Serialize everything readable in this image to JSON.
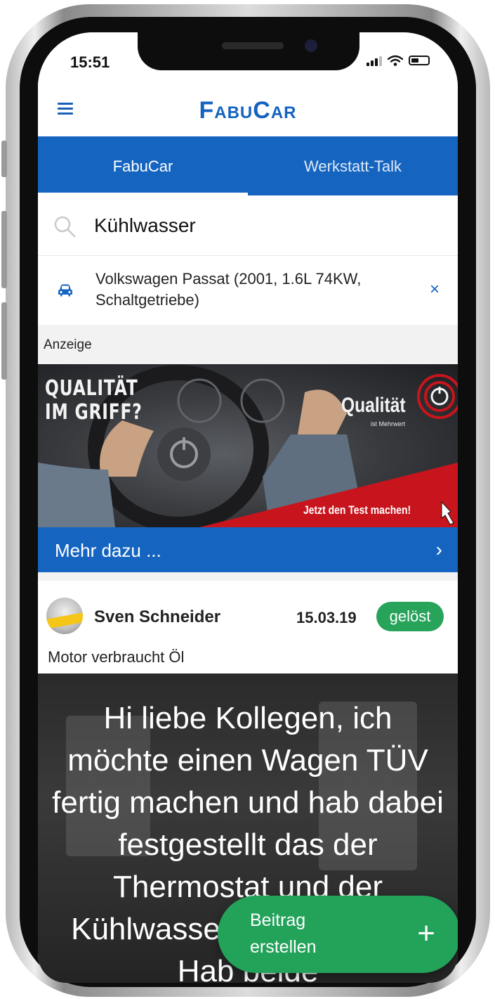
{
  "status_bar": {
    "time": "15:51"
  },
  "header": {
    "logo": "FabuCar"
  },
  "tabs": [
    {
      "label": "FabuCar",
      "active": true
    },
    {
      "label": "Werkstatt-Talk",
      "active": false
    }
  ],
  "search": {
    "value": "Kühlwasser",
    "icon": "search-icon"
  },
  "vehicle": {
    "text": "Volkswagen Passat (2001, 1.6L 74KW, Schaltgetriebe)",
    "icon": "car-icon",
    "remove_label": "×"
  },
  "ad": {
    "label": "Anzeige",
    "headline": "QUALITÄT\nIM GRIFF?",
    "brand": "Qualität",
    "brand_tagline": "ist Mehrwert",
    "cta": "Jetzt den Test machen!",
    "more_label": "Mehr dazu ...",
    "more_chevron": "›"
  },
  "post": {
    "author": "Sven Schneider",
    "date": "15.03.19",
    "status": "gelöst",
    "title": "Motor verbraucht Öl",
    "body": "Hi liebe Kollegen, ich möchte einen Wagen TÜV fertig machen und hab dabei festgestellt das der Thermostat und der Kühlwasser defekt waren. Hab beide"
  },
  "fab": {
    "label": "Beitrag erstellen",
    "plus": "+"
  },
  "colors": {
    "brand_blue": "#1565c0",
    "status_green": "#27a35a",
    "ad_red": "#c8141c"
  }
}
